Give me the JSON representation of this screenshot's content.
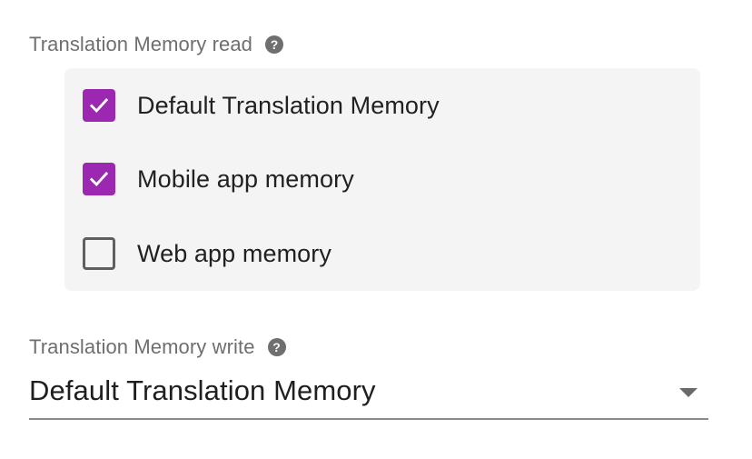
{
  "tm_read": {
    "label": "Translation Memory read",
    "help_icon": "?",
    "options": [
      {
        "label": "Default Translation Memory",
        "checked": true
      },
      {
        "label": "Mobile app memory",
        "checked": true
      },
      {
        "label": "Web app memory",
        "checked": false
      }
    ]
  },
  "tm_write": {
    "label": "Translation Memory write",
    "help_icon": "?",
    "selected_value": "Default Translation Memory"
  },
  "colors": {
    "accent": "#9c27b0",
    "label_gray": "#6f6f6f",
    "panel_bg": "#f4f4f4"
  },
  "icons": {
    "help": "help-circle-icon",
    "check": "checkmark-icon",
    "dropdown": "caret-down-icon"
  }
}
